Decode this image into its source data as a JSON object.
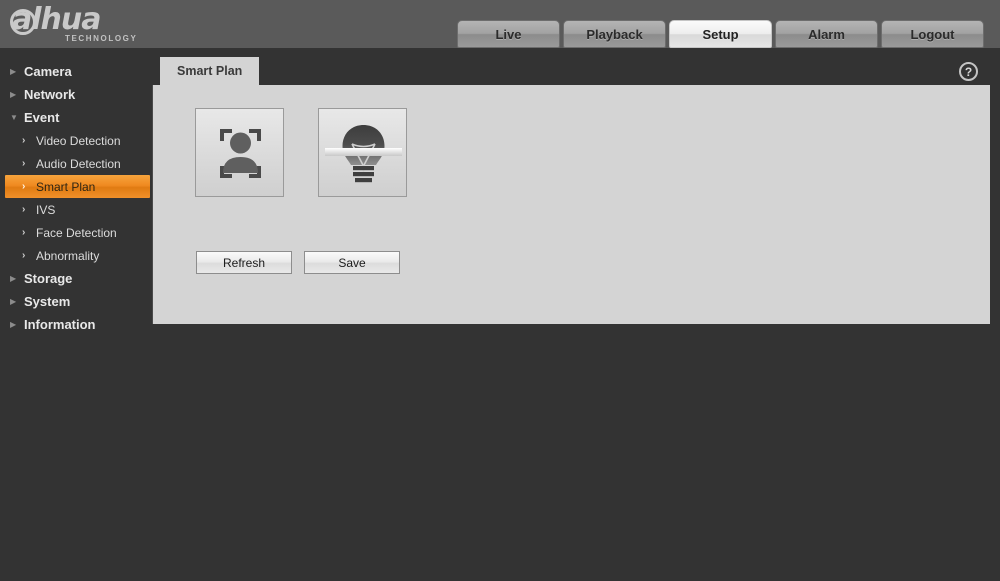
{
  "brand": {
    "logo_text": "alhua",
    "logo_subtitle": "TECHNOLOGY"
  },
  "nav_tabs": [
    {
      "label": "Live",
      "active": false
    },
    {
      "label": "Playback",
      "active": false
    },
    {
      "label": "Setup",
      "active": true
    },
    {
      "label": "Alarm",
      "active": false
    },
    {
      "label": "Logout",
      "active": false
    }
  ],
  "sidebar": {
    "items": [
      {
        "label": "Camera",
        "type": "group",
        "marker": "▶",
        "expanded": false
      },
      {
        "label": "Network",
        "type": "group",
        "marker": "▶",
        "expanded": false
      },
      {
        "label": "Event",
        "type": "group",
        "marker": "▼",
        "expanded": true
      },
      {
        "label": "Video Detection",
        "type": "sub",
        "marker": "›",
        "selected": false
      },
      {
        "label": "Audio Detection",
        "type": "sub",
        "marker": "›",
        "selected": false
      },
      {
        "label": "Smart Plan",
        "type": "sub",
        "marker": "›",
        "selected": true
      },
      {
        "label": "IVS",
        "type": "sub",
        "marker": "›",
        "selected": false
      },
      {
        "label": "Face Detection",
        "type": "sub",
        "marker": "›",
        "selected": false
      },
      {
        "label": "Abnormality",
        "type": "sub",
        "marker": "›",
        "selected": false
      },
      {
        "label": "Storage",
        "type": "group",
        "marker": "▶",
        "expanded": false
      },
      {
        "label": "System",
        "type": "group",
        "marker": "▶",
        "expanded": false
      },
      {
        "label": "Information",
        "type": "group",
        "marker": "▶",
        "expanded": false
      }
    ]
  },
  "panel": {
    "tab_label": "Smart Plan",
    "help_label": "?",
    "help_icon": "question-mark-icon",
    "tiles": [
      {
        "icon": "face-detection-icon",
        "name": "face-detection-plan"
      },
      {
        "icon": "lightbulb-icon",
        "name": "ivs-plan"
      }
    ],
    "buttons": [
      {
        "label": "Refresh",
        "name": "refresh-button"
      },
      {
        "label": "Save",
        "name": "save-button"
      }
    ]
  },
  "colors": {
    "accent_orange": "#f08a21",
    "header_gray": "#5a5a5a",
    "background_dark": "#333333",
    "panel_gray": "#d4d4d4"
  }
}
